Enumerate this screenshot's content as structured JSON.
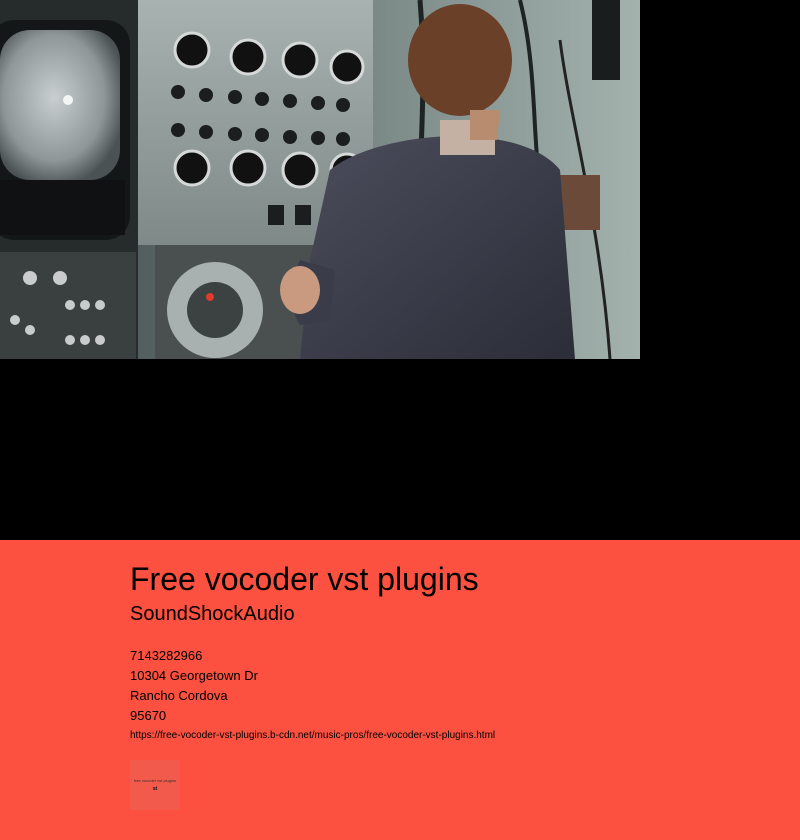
{
  "hero": {
    "image_subject": "man in suit operating a vintage electronic synthesizer panel"
  },
  "info": {
    "title": "Free vocoder vst plugins",
    "brand": "SoundShockAudio",
    "phone": "7143282966",
    "street": "10304 Georgetown Dr",
    "city": "Rancho Cordova",
    "zip": "95670",
    "url": "https://free-vocoder-vst-plugins.b-cdn.net/music-pros/free-vocoder-vst-plugins.html",
    "thumbnail": {
      "label": "free vocoder vst plugins",
      "ext": "st"
    }
  },
  "colors": {
    "info_background": "#fc5140",
    "page_background": "#000000"
  }
}
